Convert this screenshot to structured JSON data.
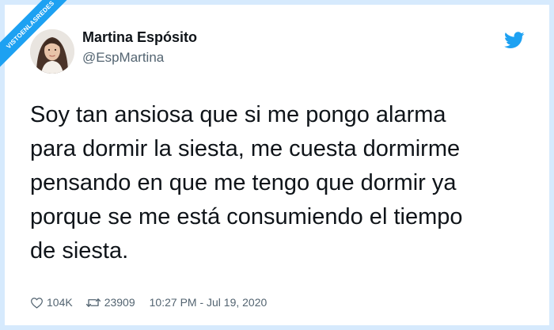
{
  "watermark": {
    "text": "VISTOENLASREDES"
  },
  "author": {
    "display_name": "Martina Espósito",
    "handle": "@EspMartina"
  },
  "tweet": {
    "text": "Soy tan ansiosa que si me pongo alarma\npara dormir la siesta, me cuesta dormirme\npensando en que me tengo que dormir ya\nporque se me está consumiendo el tiempo\nde siesta.",
    "likes": "104K",
    "retweets": "23909",
    "timestamp": "10:27 PM - Jul 19, 2020"
  },
  "icons": {
    "brand": "twitter-bird-icon",
    "like": "heart-outline-icon",
    "retweet": "retweet-arrows-icon"
  },
  "colors": {
    "brand_blue": "#1da1f2",
    "frame": "#d6eafd",
    "text_primary": "#0f1419",
    "text_secondary": "#536471"
  }
}
